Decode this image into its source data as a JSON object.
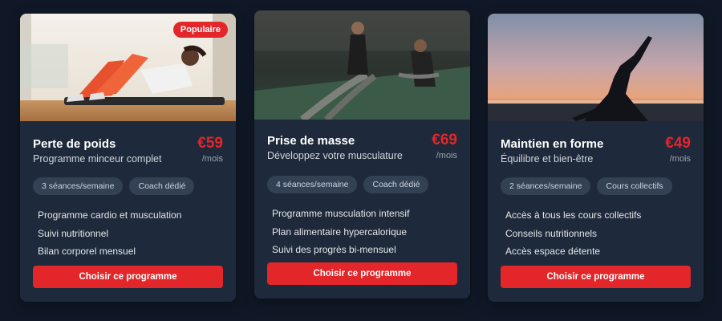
{
  "programs": [
    {
      "photo": "woman-doing-crunches-on-mat",
      "badge": "Populaire",
      "title": "Perte de poids",
      "subtitle": "Programme minceur complet",
      "price": "€59",
      "per": "/mois",
      "chips": [
        "3 séances/semaine",
        "Coach dédié"
      ],
      "features": [
        "Programme cardio et musculation",
        "Suivi nutritionnel",
        "Bilan corporel mensuel"
      ],
      "cta": "Choisir ce programme"
    },
    {
      "photo": "people-training-with-battle-ropes",
      "title": "Prise de masse",
      "subtitle": "Développez votre musculature",
      "price": "€69",
      "per": "/mois",
      "chips": [
        "4 séances/semaine",
        "Coach dédié"
      ],
      "features": [
        "Programme musculation intensif",
        "Plan alimentaire hypercalorique",
        "Suivi des progrès bi-mensuel"
      ],
      "cta": "Choisir ce programme"
    },
    {
      "photo": "yoga-silhouette-at-sunset",
      "title": "Maintien en forme",
      "subtitle": "Équilibre et bien-être",
      "price": "€49",
      "per": "/mois",
      "chips": [
        "2 séances/semaine",
        "Cours collectifs"
      ],
      "features": [
        "Accès à tous les cours collectifs",
        "Conseils nutritionnels",
        "Accès espace détente"
      ],
      "cta": "Choisir ce programme"
    }
  ],
  "colors": {
    "background": "#101827",
    "card": "#1e293b",
    "accent": "#e3262a",
    "chip": "#334155"
  }
}
